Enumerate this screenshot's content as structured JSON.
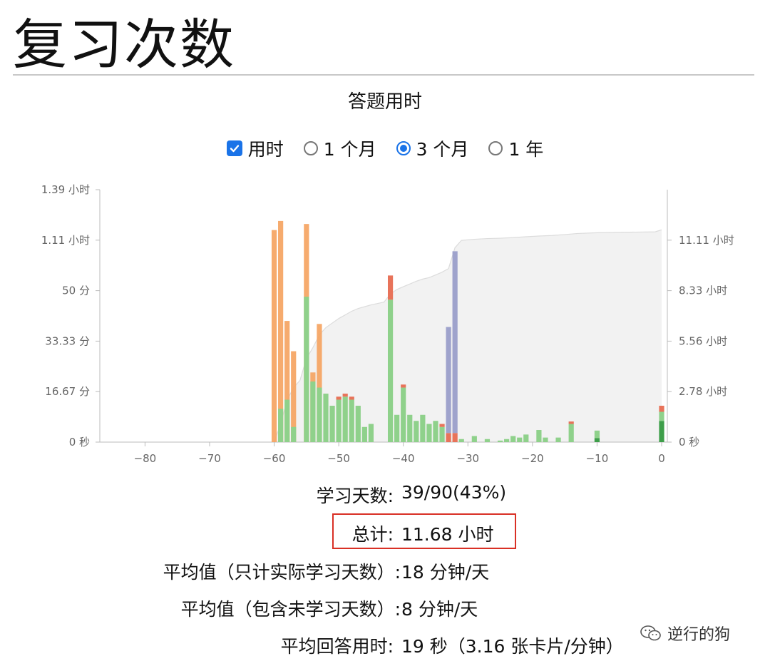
{
  "page": {
    "title": "复习次数"
  },
  "chart_title": "答题用时",
  "controls": [
    {
      "type": "checkbox",
      "label": "用时",
      "checked": true
    },
    {
      "type": "radio",
      "label": "1 个月",
      "checked": false
    },
    {
      "type": "radio",
      "label": "3 个月",
      "checked": true
    },
    {
      "type": "radio",
      "label": "1 年",
      "checked": false
    }
  ],
  "stats": {
    "days_label": "学习天数:",
    "days_value": "39/90(43%)",
    "total_label": "总计:",
    "total_value": "11.68 小时",
    "avg_study_label": "平均值（只计实际学习天数）:",
    "avg_study_value": "18 分钟/天",
    "avg_all_label": "平均值（包含未学习天数）:",
    "avg_all_value": "8 分钟/天",
    "avg_answer_label": "平均回答用时:",
    "avg_answer_value": "19 秒（3.16 张卡片/分钟）"
  },
  "watermark": "逆行的狗",
  "colors": {
    "orange": "#f5a462",
    "green": "#8fd18b",
    "red": "#e8735a",
    "purple": "#9fa3cc",
    "darkgreen": "#3e9e4a",
    "area": "#f2f2f2",
    "area_line": "#dcdcdc",
    "axis_text": "#666666",
    "highlight": "#d93025"
  },
  "chart_data": {
    "type": "bar",
    "x_label": "",
    "y_label": "",
    "xlim": [
      -87,
      0
    ],
    "x_ticks": [
      -80,
      -70,
      -60,
      -50,
      -40,
      -30,
      -20,
      -10,
      0
    ],
    "y_left_ticks": [
      "0 秒",
      "16.67 分",
      "33.33 分",
      "50 分",
      "1.11 小时",
      "1.39 小时"
    ],
    "y_left_max_minutes": 83.33,
    "y_right_ticks": [
      "0 秒",
      "2.78 小时",
      "5.56 小时",
      "8.33 小时",
      "11.11 小时"
    ],
    "y_right_max_hours": 13.89,
    "stacked_series": [
      "young",
      "mature",
      "relearn",
      "learn"
    ],
    "bars": [
      {
        "x": -60,
        "orange": 70,
        "green": 0,
        "red": 0,
        "purple": 0,
        "darkgreen": 0
      },
      {
        "x": -59,
        "orange": 73,
        "green": 11,
        "red": 0,
        "purple": 0,
        "darkgreen": 0
      },
      {
        "x": -58,
        "orange": 40,
        "green": 14,
        "red": 0,
        "purple": 0,
        "darkgreen": 0
      },
      {
        "x": -57,
        "orange": 30,
        "green": 5,
        "red": 0,
        "purple": 0,
        "darkgreen": 0
      },
      {
        "x": -55,
        "orange": 72,
        "green": 48,
        "red": 0,
        "purple": 0,
        "darkgreen": 0
      },
      {
        "x": -54,
        "orange": 23,
        "green": 20,
        "red": 0,
        "purple": 0,
        "darkgreen": 0
      },
      {
        "x": -53,
        "orange": 39,
        "green": 18,
        "red": 0,
        "purple": 0,
        "darkgreen": 0
      },
      {
        "x": -52,
        "orange": 0,
        "green": 16,
        "red": 0,
        "purple": 0,
        "darkgreen": 0
      },
      {
        "x": -51,
        "orange": 0,
        "green": 12,
        "red": 0,
        "purple": 0,
        "darkgreen": 0
      },
      {
        "x": -50,
        "orange": 0,
        "green": 14,
        "red": 1,
        "purple": 0,
        "darkgreen": 0
      },
      {
        "x": -49,
        "orange": 0,
        "green": 15,
        "red": 1,
        "purple": 0,
        "darkgreen": 0
      },
      {
        "x": -48,
        "orange": 0,
        "green": 14,
        "red": 1,
        "purple": 0,
        "darkgreen": 0
      },
      {
        "x": -47,
        "orange": 0,
        "green": 12,
        "red": 0,
        "purple": 0,
        "darkgreen": 0
      },
      {
        "x": -46,
        "orange": 0,
        "green": 5,
        "red": 0,
        "purple": 0,
        "darkgreen": 0
      },
      {
        "x": -45,
        "orange": 0,
        "green": 6,
        "red": 0,
        "purple": 0,
        "darkgreen": 0
      },
      {
        "x": -42,
        "orange": 0,
        "green": 47,
        "red": 8,
        "purple": 0,
        "darkgreen": 0
      },
      {
        "x": -41,
        "orange": 0,
        "green": 9,
        "red": 0,
        "purple": 0,
        "darkgreen": 0
      },
      {
        "x": -40,
        "orange": 0,
        "green": 18,
        "red": 1,
        "purple": 0,
        "darkgreen": 0
      },
      {
        "x": -39,
        "orange": 0,
        "green": 9,
        "red": 0,
        "purple": 0,
        "darkgreen": 0
      },
      {
        "x": -38,
        "orange": 0,
        "green": 7,
        "red": 0,
        "purple": 0,
        "darkgreen": 0
      },
      {
        "x": -37,
        "orange": 0,
        "green": 9,
        "red": 0,
        "purple": 0,
        "darkgreen": 0
      },
      {
        "x": -36,
        "orange": 0,
        "green": 6,
        "red": 0,
        "purple": 0,
        "darkgreen": 0
      },
      {
        "x": -35,
        "orange": 0,
        "green": 7,
        "red": 0,
        "purple": 0,
        "darkgreen": 0
      },
      {
        "x": -34,
        "orange": 0,
        "green": 5,
        "red": 1,
        "purple": 0,
        "darkgreen": 0
      },
      {
        "x": -33,
        "orange": 0,
        "green": 0,
        "red": 3,
        "purple": 38,
        "darkgreen": 0
      },
      {
        "x": -32,
        "orange": 0,
        "green": 0,
        "red": 3,
        "purple": 63,
        "darkgreen": 0
      },
      {
        "x": -31,
        "orange": 0,
        "green": 1,
        "red": 0,
        "purple": 0,
        "darkgreen": 0
      },
      {
        "x": -29,
        "orange": 0,
        "green": 2,
        "red": 0,
        "purple": 0,
        "darkgreen": 0
      },
      {
        "x": -27,
        "orange": 0,
        "green": 1,
        "red": 0,
        "purple": 0,
        "darkgreen": 0
      },
      {
        "x": -25,
        "orange": 0,
        "green": 0.5,
        "red": 0,
        "purple": 0,
        "darkgreen": 0
      },
      {
        "x": -24,
        "orange": 0,
        "green": 1,
        "red": 0,
        "purple": 0,
        "darkgreen": 0
      },
      {
        "x": -23,
        "orange": 0,
        "green": 2,
        "red": 0,
        "purple": 0,
        "darkgreen": 0
      },
      {
        "x": -22,
        "orange": 0,
        "green": 1.5,
        "red": 0,
        "purple": 0,
        "darkgreen": 0
      },
      {
        "x": -21,
        "orange": 0,
        "green": 2.5,
        "red": 0,
        "purple": 0,
        "darkgreen": 0
      },
      {
        "x": -19,
        "orange": 0,
        "green": 4,
        "red": 0,
        "purple": 0,
        "darkgreen": 0
      },
      {
        "x": -18,
        "orange": 0,
        "green": 1.5,
        "red": 0,
        "purple": 0,
        "darkgreen": 0
      },
      {
        "x": -16,
        "orange": 0,
        "green": 1.5,
        "red": 0,
        "purple": 0,
        "darkgreen": 0
      },
      {
        "x": -14,
        "orange": 0,
        "green": 6,
        "red": 0.8,
        "purple": 0,
        "darkgreen": 0
      },
      {
        "x": -10,
        "orange": 0,
        "green": 2.5,
        "red": 0,
        "purple": 0,
        "darkgreen": 1.3
      },
      {
        "x": 0,
        "orange": 0,
        "green": 3,
        "red": 2,
        "purple": 0,
        "darkgreen": 7
      }
    ],
    "cumulative_hours": [
      [
        -60,
        0
      ],
      [
        -59,
        1.0
      ],
      [
        -58,
        2.3
      ],
      [
        -57,
        3.0
      ],
      [
        -56,
        3.4
      ],
      [
        -55,
        4.6
      ],
      [
        -54,
        5.2
      ],
      [
        -53,
        5.9
      ],
      [
        -52,
        6.3
      ],
      [
        -51,
        6.55
      ],
      [
        -50,
        6.8
      ],
      [
        -49,
        7.0
      ],
      [
        -48,
        7.2
      ],
      [
        -47,
        7.35
      ],
      [
        -46,
        7.45
      ],
      [
        -45,
        7.55
      ],
      [
        -43,
        7.7
      ],
      [
        -42,
        8.15
      ],
      [
        -41,
        8.4
      ],
      [
        -40,
        8.55
      ],
      [
        -39,
        8.7
      ],
      [
        -38,
        8.85
      ],
      [
        -37,
        8.97
      ],
      [
        -36,
        9.05
      ],
      [
        -35,
        9.2
      ],
      [
        -34,
        9.35
      ],
      [
        -33,
        9.55
      ],
      [
        -32,
        10.7
      ],
      [
        -31,
        11.1
      ],
      [
        -29,
        11.16
      ],
      [
        -27,
        11.2
      ],
      [
        -25,
        11.22
      ],
      [
        -23,
        11.25
      ],
      [
        -21,
        11.3
      ],
      [
        -19,
        11.34
      ],
      [
        -17,
        11.37
      ],
      [
        -15,
        11.42
      ],
      [
        -13,
        11.48
      ],
      [
        -10,
        11.52
      ],
      [
        -5,
        11.55
      ],
      [
        -1,
        11.57
      ],
      [
        0,
        11.68
      ]
    ]
  }
}
